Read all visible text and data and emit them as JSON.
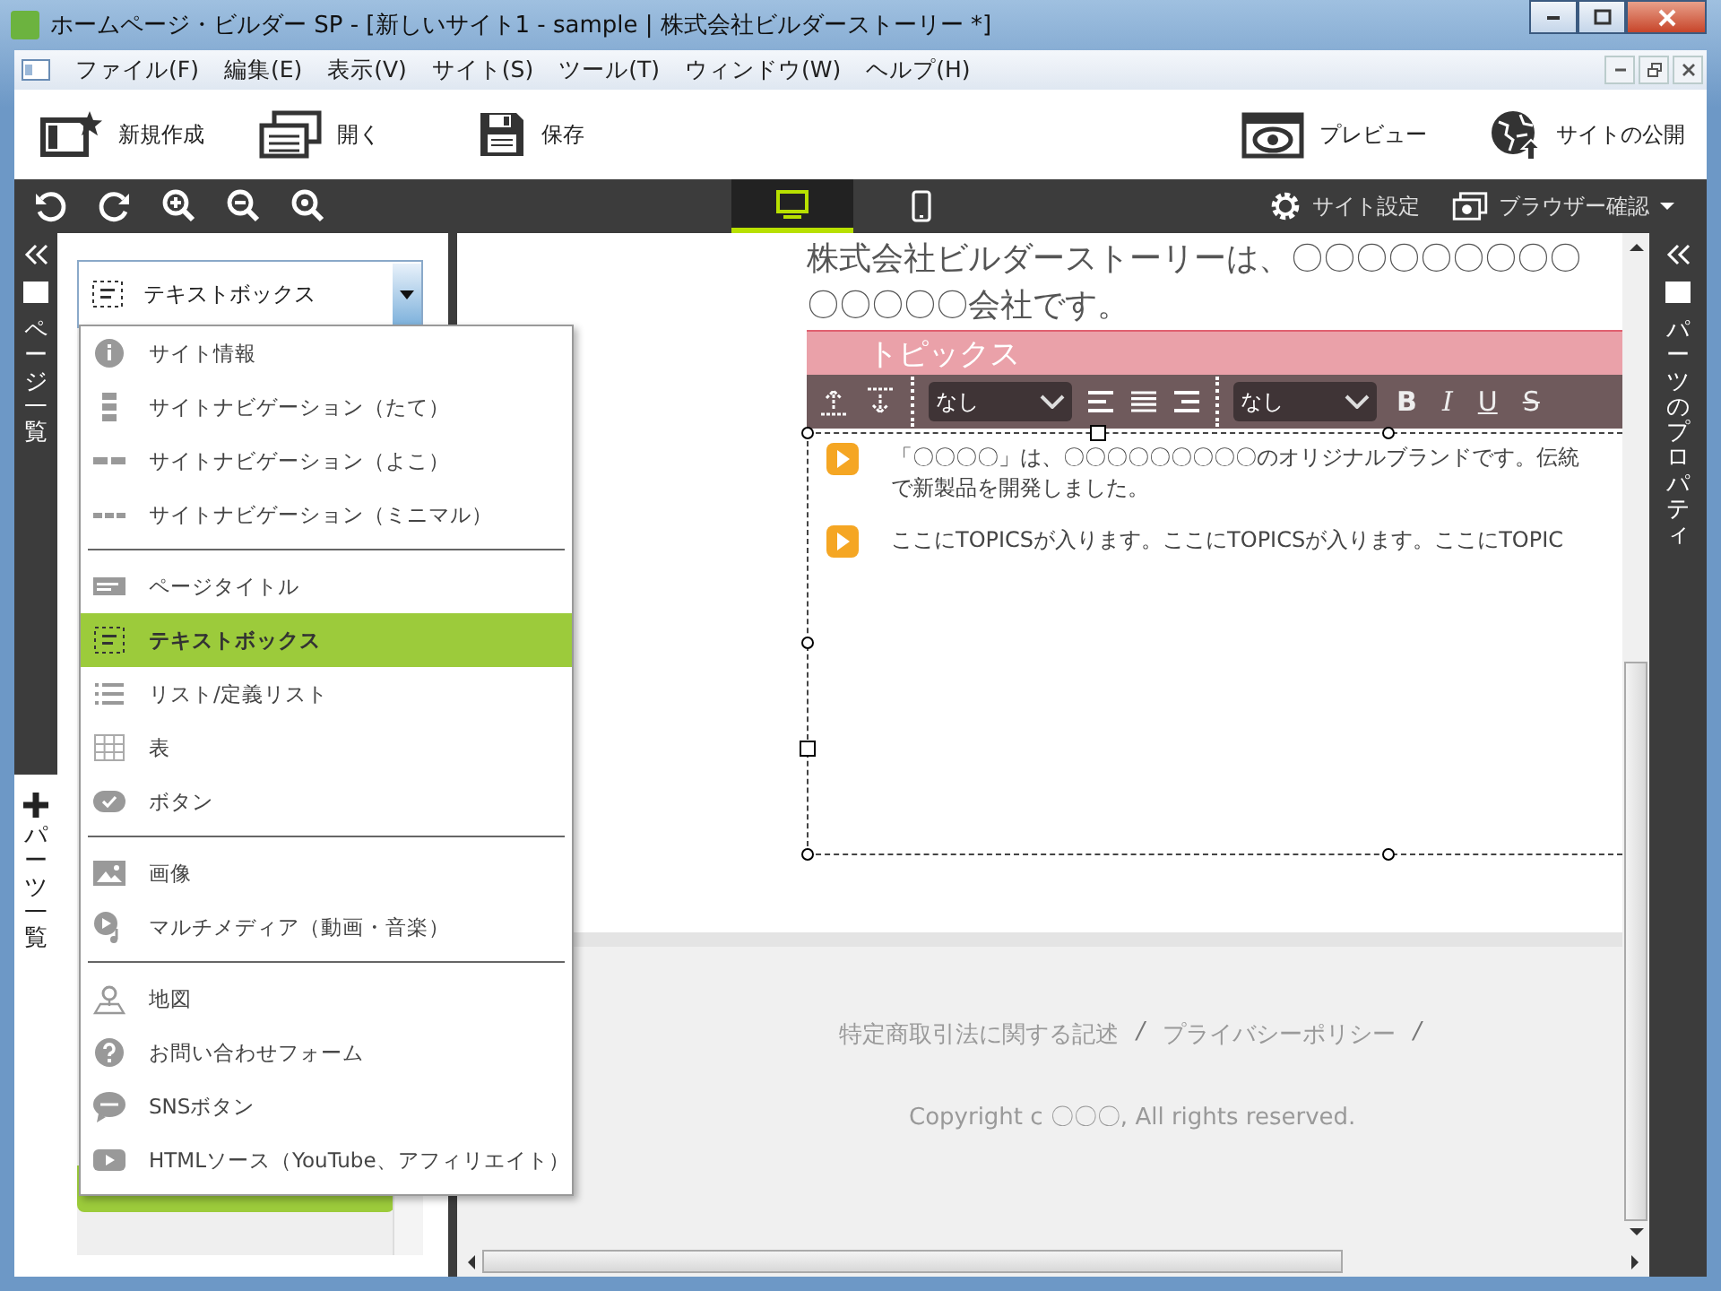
{
  "window": {
    "title": "ホームページ・ビルダー SP - [新しいサイト1 - sample | 株式会社ビルダーストーリー *]"
  },
  "menu": [
    "ファイル(F)",
    "編集(E)",
    "表示(V)",
    "サイト(S)",
    "ツール(T)",
    "ウィンドウ(W)",
    "ヘルプ(H)"
  ],
  "toolbar": {
    "left": [
      {
        "label": "新規作成"
      },
      {
        "label": "開く"
      },
      {
        "label": "保存"
      }
    ],
    "right": [
      {
        "label": "プレビュー"
      },
      {
        "label": "サイトの公開"
      }
    ]
  },
  "view_bar": {
    "devices": [
      {
        "kind": "desktop",
        "selected": true
      },
      {
        "kind": "mobile",
        "selected": false
      }
    ],
    "right": [
      {
        "label": "サイト設定"
      },
      {
        "label": "ブラウザー確認"
      }
    ]
  },
  "left_strip": {
    "top_label": "ページ一覧",
    "bottom_label": "パーツ一覧"
  },
  "parts_dropdown": {
    "value": "テキストボックス",
    "groups": [
      [
        {
          "label": "サイト情報",
          "selected": false
        },
        {
          "label": "サイトナビゲーション（たて）",
          "selected": false
        },
        {
          "label": "サイトナビゲーション（よこ）",
          "selected": false
        },
        {
          "label": "サイトナビゲーション（ミニマル）",
          "selected": false
        }
      ],
      [
        {
          "label": "ページタイトル",
          "selected": false
        },
        {
          "label": "テキストボックス",
          "selected": true
        },
        {
          "label": "リスト/定義リスト",
          "selected": false
        },
        {
          "label": "表",
          "selected": false
        },
        {
          "label": "ボタン",
          "selected": false
        }
      ],
      [
        {
          "label": "画像",
          "selected": false
        },
        {
          "label": "マルチメディア（動画・音楽）",
          "selected": false
        }
      ],
      [
        {
          "label": "地図",
          "selected": false
        },
        {
          "label": "お問い合わせフォーム",
          "selected": false
        },
        {
          "label": "SNSボタン",
          "selected": false
        },
        {
          "label": "HTMLソース（YouTube、アフィリエイト）",
          "selected": false
        }
      ]
    ]
  },
  "canvas": {
    "intro_lines": [
      "株式会社ビルダーストーリーは、〇〇〇〇〇〇〇〇〇",
      "〇〇〇〇〇会社です。"
    ],
    "heading": "トピックス",
    "format_toolbar": {
      "block_style": "なし",
      "font_size": "なし",
      "buttons": [
        "B",
        "I",
        "U",
        "S"
      ]
    },
    "topics": [
      {
        "lines": [
          "「〇〇〇〇」は、〇〇〇〇〇〇〇〇〇のオリジナルブランドです。伝統",
          "で新製品を開発しました。"
        ]
      },
      {
        "lines": [
          "ここにTOPICSが入ります。ここにTOPICSが入ります。ここにTOPIC"
        ]
      }
    ],
    "footer_items": [
      {
        "kind": "link",
        "text": "特定商取引法に関する記述"
      },
      {
        "kind": "separator",
        "text": "/"
      },
      {
        "kind": "link",
        "text": "プライバシーポリシー"
      },
      {
        "kind": "separator",
        "text": "/"
      }
    ],
    "copyright": "Copyright c 〇〇〇, All rights reserved."
  },
  "right_strip": {
    "label": "パーツのプロパティ"
  }
}
